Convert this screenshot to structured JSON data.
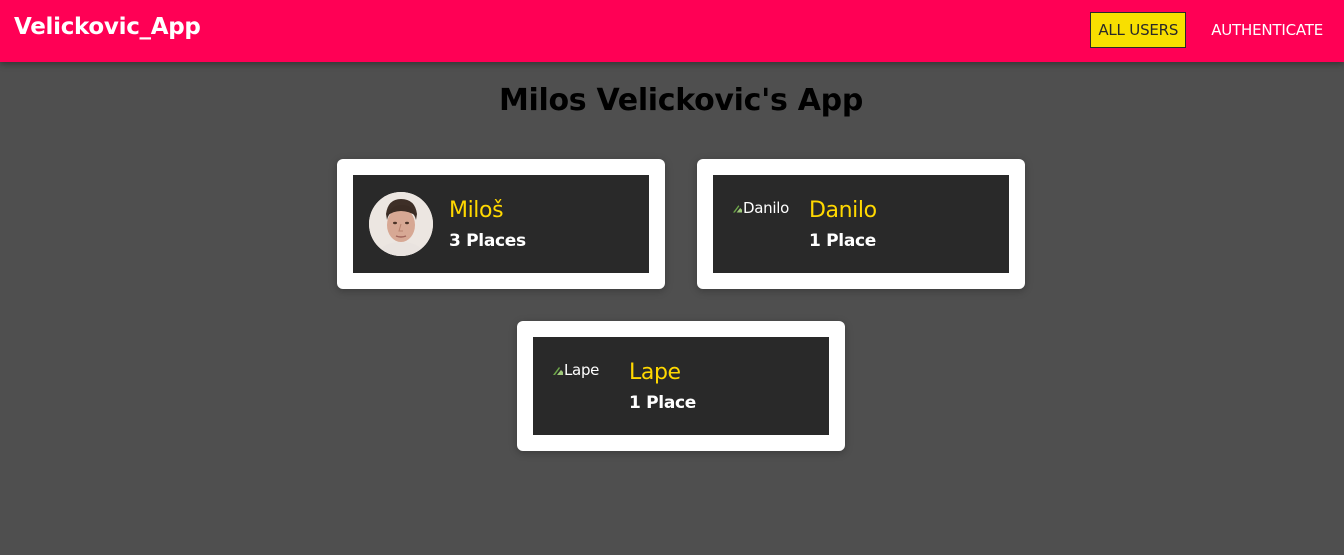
{
  "header": {
    "brand": "Velickovic_App",
    "nav": [
      {
        "label": "ALL USERS",
        "active": true
      },
      {
        "label": "AUTHENTICATE",
        "active": false
      }
    ]
  },
  "main": {
    "title": "Milos Velickovic's App",
    "users": [
      {
        "name": "Miloš",
        "places": "3 Places",
        "image": "photo",
        "image_alt": ""
      },
      {
        "name": "Danilo",
        "places": "1 Place",
        "image": "broken",
        "image_alt": "Danilo"
      },
      {
        "name": "Lape",
        "places": "1 Place",
        "image": "broken",
        "image_alt": "Lape"
      }
    ]
  },
  "colors": {
    "header_bg": "#ff0055",
    "page_bg": "#4f4f4f",
    "card_inner_bg": "#292929",
    "name_color": "#ffd800",
    "active_nav_bg": "#f8df00"
  },
  "icons": {
    "broken_image": "broken-image-icon"
  }
}
